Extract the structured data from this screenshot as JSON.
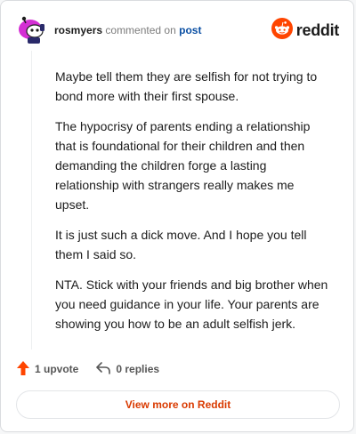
{
  "header": {
    "username": "rosmyers",
    "action_text": "commented on",
    "post_link": "post",
    "brand_name": "reddit"
  },
  "icons": {
    "avatar": "snoo-avatar-icon",
    "brand": "reddit-logo-icon",
    "upvote": "upvote-arrow-icon",
    "reply": "reply-arrow-icon"
  },
  "comment": {
    "paragraphs": [
      "Maybe tell them they are selfish for not trying to bond more with their first spouse.",
      "The hypocrisy of parents ending a relationship that is foundational for their children and then demanding the children forge a lasting relationship with strangers really makes me upset.",
      "It is just such a dick move. And I hope you tell them I said so.",
      "NTA. Stick with your friends and big brother when you need guidance in your life. Your parents are showing you how to be an adult selfish jerk."
    ]
  },
  "actions": {
    "upvotes": "1 upvote",
    "replies": "0 replies"
  },
  "footer": {
    "view_more": "View more on Reddit"
  },
  "colors": {
    "brand_orange": "#ff4500",
    "link_blue": "#0a4fa3",
    "view_more": "#d93a00",
    "avatar_magenta": "#d42fd4"
  }
}
